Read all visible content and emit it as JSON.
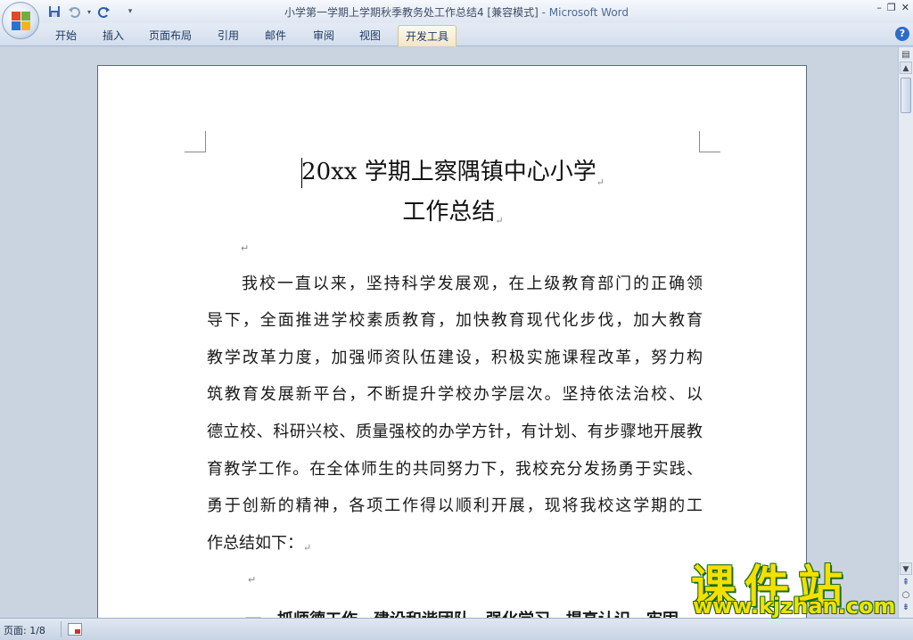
{
  "window": {
    "doc_name": "小学第一学期上学期秋季教务处工作总结4 [兼容模式]",
    "separator": " - ",
    "app_name": "Microsoft Word",
    "minimize": "–",
    "restore": "❐",
    "close": "✕"
  },
  "ribbon": {
    "tabs": [
      {
        "label": "开始"
      },
      {
        "label": "插入"
      },
      {
        "label": "页面布局"
      },
      {
        "label": "引用"
      },
      {
        "label": "邮件"
      },
      {
        "label": "审阅"
      },
      {
        "label": "视图"
      },
      {
        "label": "开发工具",
        "active": true
      }
    ],
    "help": "?"
  },
  "qat": {
    "save_icon": "save-icon",
    "undo_icon": "undo-icon",
    "redo_icon": "redo-icon"
  },
  "document": {
    "title_line1": "20xx 学期上察隅镇中心小学",
    "title_line2": "工作总结",
    "para_mark": "↵",
    "body_lines": [
      "我校一直以来，坚持科学发展观，在上级教育部门的正确领",
      "导下，全面推进学校素质教育，加快教育现代化步伐，加大教育",
      "教学改革力度，加强师资队伍建设，积极实施课程改革，努力构",
      "筑教育发展新平台，不断提升学校办学层次。坚持依法治校、以",
      "德立校、科研兴校、质量强校的办学方针，有计划、有步骤地开展教",
      "育教学工作。在全体师生的共同努力下，我校充分发扬勇于实践、",
      "勇于创新的精神，各项工作得以顺利开展，现将我校这学期的工",
      "作总结如下："
    ],
    "next_heading_partial": "一、抓师德工作，建设和谐团队，强化学习，提高认识，牢固"
  },
  "status": {
    "page": "页面: 1/8"
  },
  "watermark": {
    "text": "课件站",
    "url": "www.kjzhan.com"
  }
}
